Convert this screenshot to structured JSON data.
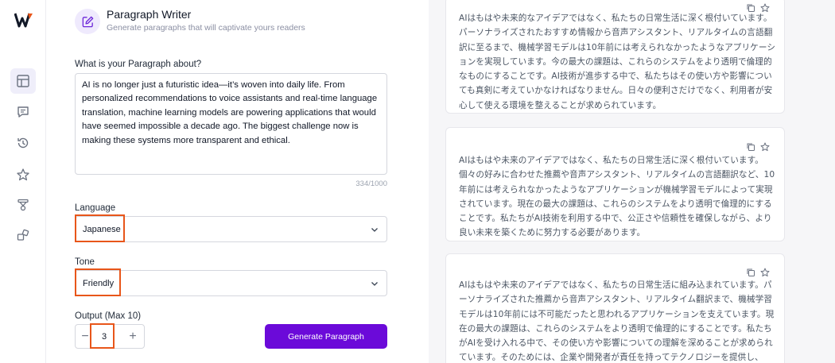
{
  "app": {
    "header": {
      "title": "Paragraph Writer",
      "subtitle": "Generate paragraphs that will captivate yours readers"
    },
    "sidebar": {
      "items": [
        {
          "icon": "layout-icon",
          "active": true
        },
        {
          "icon": "chat-icon",
          "active": false
        },
        {
          "icon": "history-icon",
          "active": false
        },
        {
          "icon": "star-icon",
          "active": false
        },
        {
          "icon": "funnel-icon",
          "active": false
        },
        {
          "icon": "shapes-icon",
          "active": false
        }
      ]
    },
    "form": {
      "topic_label": "What is your Paragraph about?",
      "topic_value": "AI is no longer just a futuristic idea—it’s woven into daily life. From personalized recommendations to voice assistants and real-time language translation, machine learning models are powering applications that would have seemed impossible a decade ago. The biggest challenge now is making these systems more transparent and ethical.",
      "counter": "334/1000",
      "language_label": "Language",
      "language_value": "Japanese",
      "tone_label": "Tone",
      "tone_value": "Friendly",
      "output_label": "Output (Max 10)",
      "output_value": "3",
      "minus": "−",
      "plus": "+",
      "generate_label": "Generate Paragraph"
    },
    "results": [
      {
        "text": "AIはもはや未来的なアイデアではなく、私たちの日常生活に深く根付いています。パーソナライズされたおすすめ情報から音声アシスタント、リアルタイムの言語翻訳に至るまで、機械学習モデルは10年前には考えられなかったようなアプリケーションを実現しています。今の最大の課題は、これらのシステムをより透明で倫理的なものにすることです。AI技術が進歩する中で、私たちはその使い方や影響についても真剣に考えていかなければなりません。日々の便利さだけでなく、利用者が安心して使える環境を整えることが求められています。"
      },
      {
        "text": "AIはもはや未来のアイデアではなく、私たちの日常生活に深く根付いています。個々の好みに合わせた推薦や音声アシスタント、リアルタイムの言語翻訳など、10年前には考えられなかったようなアプリケーションが機械学習モデルによって実現されています。現在の最大の課題は、これらのシステムをより透明で倫理的にすることです。私たちがAI技術を利用する中で、公正さや信頼性を確保しながら、より良い未来を築くために努力する必要があります。"
      },
      {
        "text": "AIはもはや未来のアイデアではなく、私たちの日常生活に組み込まれています。パーソナライズされた推薦から音声アシスタント、リアルタイム翻訳まで、機械学習モデルは10年前には不可能だったと思われるアプリケーションを支えています。現在の最大の課題は、これらのシステムをより透明で倫理的にすることです。私たちがAIを受け入れる中で、その使い方や影響についての理解を深めることが求められています。そのためには、企業や開発者が責任を持ってテクノロジーを提供し、人々がその利用方法について明確に理解できるよう努める必要があります。"
      }
    ],
    "colors": {
      "accent": "#6b0ad9",
      "highlight": "#e8561a"
    }
  }
}
